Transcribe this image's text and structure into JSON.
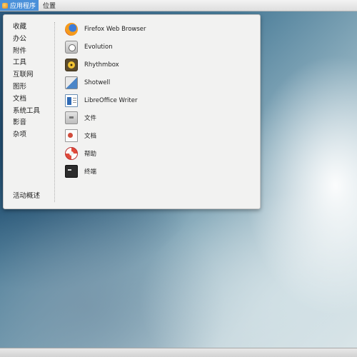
{
  "topbar": {
    "applications_label": "应用程序",
    "places_label": "位置"
  },
  "categories": [
    {
      "label": "收藏"
    },
    {
      "label": "办公"
    },
    {
      "label": "附件"
    },
    {
      "label": "工具"
    },
    {
      "label": "互联网"
    },
    {
      "label": "图形"
    },
    {
      "label": "文档"
    },
    {
      "label": "系统工具"
    },
    {
      "label": "影音"
    },
    {
      "label": "杂项"
    }
  ],
  "activities_label": "活动概述",
  "apps": [
    {
      "label": "Firefox Web Browser",
      "icon": "firefox-icon"
    },
    {
      "label": "Evolution",
      "icon": "evolution-icon"
    },
    {
      "label": "Rhythmbox",
      "icon": "rhythmbox-icon"
    },
    {
      "label": "Shotwell",
      "icon": "shotwell-icon"
    },
    {
      "label": "LibreOffice Writer",
      "icon": "libreoffice-writer-icon"
    },
    {
      "label": "文件",
      "icon": "files-icon"
    },
    {
      "label": "文档",
      "icon": "documents-icon"
    },
    {
      "label": "帮助",
      "icon": "help-icon"
    },
    {
      "label": "终端",
      "icon": "terminal-icon"
    }
  ],
  "colors": {
    "accent": "#4a90d9",
    "menu_background": "#f2f2f1"
  }
}
